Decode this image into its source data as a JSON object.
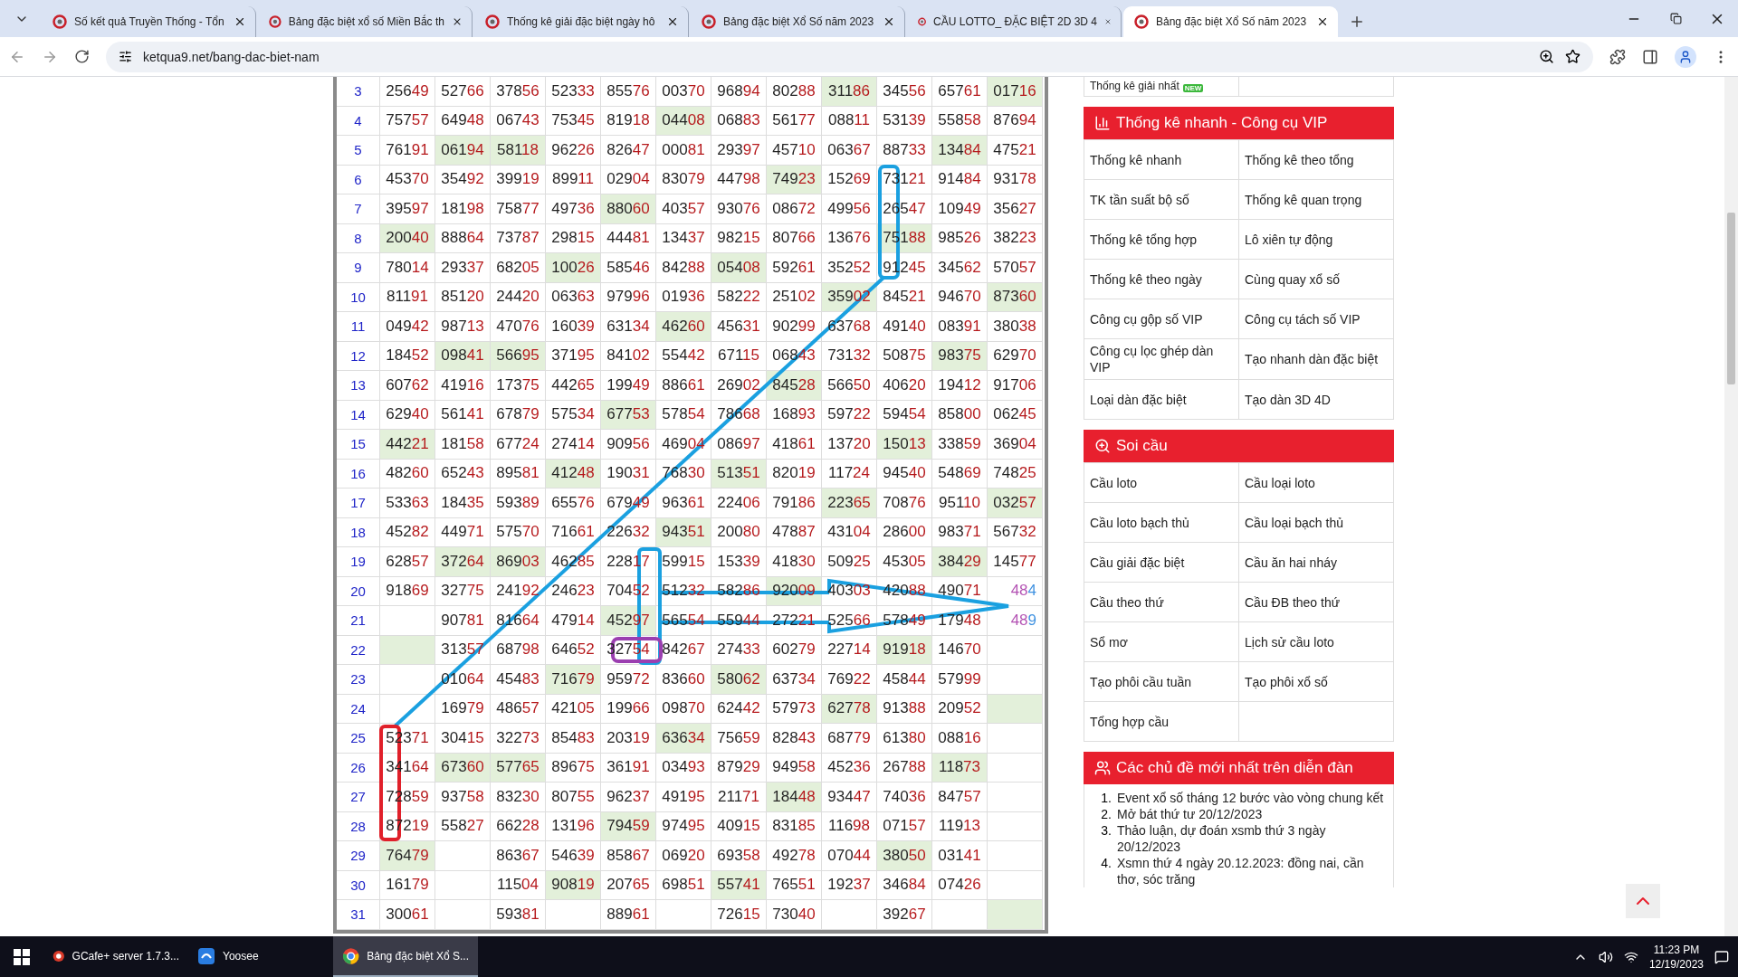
{
  "browser": {
    "tabs": [
      {
        "title": "Số kết quả Truyền Thống - Tổn",
        "selected": false
      },
      {
        "title": "Bảng đặc biệt xổ số Miền Bắc th",
        "selected": false
      },
      {
        "title": "Thống kê giải đặc biệt ngày hô",
        "selected": false
      },
      {
        "title": "Bảng đặc biệt Xổ Số năm 2023",
        "selected": false
      },
      {
        "title": "CẦU LOTTO_ ĐẶC BIỆT 2D 3D 4",
        "selected": false
      },
      {
        "title": "Bảng đặc biệt Xổ Số năm 2023",
        "selected": true
      }
    ],
    "url": "ketqua9.net/bang-dac-biet-nam"
  },
  "table": {
    "rows": [
      {
        "day": "3",
        "cells": [
          {
            "v": "25649",
            "hot": false
          },
          {
            "v": "52766",
            "hot": false
          },
          {
            "v": "37856",
            "hot": false
          },
          {
            "v": "52333",
            "hot": false
          },
          {
            "v": "85576",
            "hot": false
          },
          {
            "v": "00370",
            "hot": false
          },
          {
            "v": "96894",
            "hot": false
          },
          {
            "v": "80288",
            "hot": false
          },
          {
            "v": "31186",
            "hot": true
          },
          {
            "v": "34556",
            "hot": false
          },
          {
            "v": "65761",
            "hot": false
          },
          {
            "v": "01716",
            "hot": true
          }
        ]
      },
      {
        "day": "4",
        "cells": [
          {
            "v": "75757",
            "hot": false
          },
          {
            "v": "64948",
            "hot": false
          },
          {
            "v": "06743",
            "hot": false
          },
          {
            "v": "75345",
            "hot": false
          },
          {
            "v": "81918",
            "hot": false
          },
          {
            "v": "04408",
            "hot": true
          },
          {
            "v": "06883",
            "hot": false
          },
          {
            "v": "56177",
            "hot": false
          },
          {
            "v": "08811",
            "hot": false
          },
          {
            "v": "53139",
            "hot": false
          },
          {
            "v": "55858",
            "hot": false
          },
          {
            "v": "87694",
            "hot": false
          }
        ]
      },
      {
        "day": "5",
        "cells": [
          {
            "v": "76191",
            "hot": false
          },
          {
            "v": "06194",
            "hot": true
          },
          {
            "v": "58118",
            "hot": true
          },
          {
            "v": "96226",
            "hot": false
          },
          {
            "v": "82647",
            "hot": false
          },
          {
            "v": "00081",
            "hot": false
          },
          {
            "v": "29397",
            "hot": false
          },
          {
            "v": "45710",
            "hot": false
          },
          {
            "v": "06367",
            "hot": false
          },
          {
            "v": "88733",
            "hot": false
          },
          {
            "v": "13484",
            "hot": true
          },
          {
            "v": "47521",
            "hot": false
          }
        ]
      },
      {
        "day": "6",
        "cells": [
          {
            "v": "45370",
            "hot": false
          },
          {
            "v": "35492",
            "hot": false
          },
          {
            "v": "39919",
            "hot": false
          },
          {
            "v": "89911",
            "hot": false
          },
          {
            "v": "02904",
            "hot": false
          },
          {
            "v": "83079",
            "hot": false
          },
          {
            "v": "44798",
            "hot": false
          },
          {
            "v": "74923",
            "hot": true
          },
          {
            "v": "15269",
            "hot": false
          },
          {
            "v": "73121",
            "hot": false
          },
          {
            "v": "91484",
            "hot": false
          },
          {
            "v": "93178",
            "hot": false
          }
        ]
      },
      {
        "day": "7",
        "cells": [
          {
            "v": "39597",
            "hot": false
          },
          {
            "v": "18198",
            "hot": false
          },
          {
            "v": "75877",
            "hot": false
          },
          {
            "v": "49736",
            "hot": false
          },
          {
            "v": "88060",
            "hot": true
          },
          {
            "v": "40357",
            "hot": false
          },
          {
            "v": "93076",
            "hot": false
          },
          {
            "v": "08672",
            "hot": false
          },
          {
            "v": "49956",
            "hot": false
          },
          {
            "v": "26547",
            "hot": false
          },
          {
            "v": "10949",
            "hot": false
          },
          {
            "v": "35627",
            "hot": false
          }
        ]
      },
      {
        "day": "8",
        "cells": [
          {
            "v": "20040",
            "hot": true
          },
          {
            "v": "88864",
            "hot": false
          },
          {
            "v": "73787",
            "hot": false
          },
          {
            "v": "29815",
            "hot": false
          },
          {
            "v": "44481",
            "hot": false
          },
          {
            "v": "13437",
            "hot": false
          },
          {
            "v": "98215",
            "hot": false
          },
          {
            "v": "80766",
            "hot": false
          },
          {
            "v": "13676",
            "hot": false
          },
          {
            "v": "75188",
            "hot": true
          },
          {
            "v": "98526",
            "hot": false
          },
          {
            "v": "38223",
            "hot": false
          }
        ]
      },
      {
        "day": "9",
        "cells": [
          {
            "v": "78014",
            "hot": false
          },
          {
            "v": "29337",
            "hot": false
          },
          {
            "v": "68205",
            "hot": false
          },
          {
            "v": "10026",
            "hot": true
          },
          {
            "v": "58546",
            "hot": false
          },
          {
            "v": "84288",
            "hot": false
          },
          {
            "v": "05408",
            "hot": true
          },
          {
            "v": "59261",
            "hot": false
          },
          {
            "v": "35252",
            "hot": false
          },
          {
            "v": "91245",
            "hot": false
          },
          {
            "v": "34562",
            "hot": false
          },
          {
            "v": "57057",
            "hot": false
          }
        ]
      },
      {
        "day": "10",
        "cells": [
          {
            "v": "81191",
            "hot": false
          },
          {
            "v": "85120",
            "hot": false
          },
          {
            "v": "24420",
            "hot": false
          },
          {
            "v": "06363",
            "hot": false
          },
          {
            "v": "97996",
            "hot": false
          },
          {
            "v": "01936",
            "hot": false
          },
          {
            "v": "58222",
            "hot": false
          },
          {
            "v": "25102",
            "hot": false
          },
          {
            "v": "35902",
            "hot": true
          },
          {
            "v": "84521",
            "hot": false
          },
          {
            "v": "94670",
            "hot": false
          },
          {
            "v": "87360",
            "hot": true
          }
        ]
      },
      {
        "day": "11",
        "cells": [
          {
            "v": "04942",
            "hot": false
          },
          {
            "v": "98713",
            "hot": false
          },
          {
            "v": "47076",
            "hot": false
          },
          {
            "v": "16039",
            "hot": false
          },
          {
            "v": "63134",
            "hot": false
          },
          {
            "v": "46260",
            "hot": true
          },
          {
            "v": "45631",
            "hot": false
          },
          {
            "v": "90299",
            "hot": false
          },
          {
            "v": "63768",
            "hot": false
          },
          {
            "v": "49140",
            "hot": false
          },
          {
            "v": "08391",
            "hot": false
          },
          {
            "v": "38038",
            "hot": false
          }
        ]
      },
      {
        "day": "12",
        "cells": [
          {
            "v": "18452",
            "hot": false
          },
          {
            "v": "09841",
            "hot": true
          },
          {
            "v": "56695",
            "hot": true
          },
          {
            "v": "37195",
            "hot": false
          },
          {
            "v": "84102",
            "hot": false
          },
          {
            "v": "55442",
            "hot": false
          },
          {
            "v": "67115",
            "hot": false
          },
          {
            "v": "06843",
            "hot": false
          },
          {
            "v": "73132",
            "hot": false
          },
          {
            "v": "50875",
            "hot": false
          },
          {
            "v": "98375",
            "hot": true
          },
          {
            "v": "62970",
            "hot": false
          }
        ]
      },
      {
        "day": "13",
        "cells": [
          {
            "v": "60762",
            "hot": false
          },
          {
            "v": "41916",
            "hot": false
          },
          {
            "v": "17375",
            "hot": false
          },
          {
            "v": "44265",
            "hot": false
          },
          {
            "v": "19949",
            "hot": false
          },
          {
            "v": "88661",
            "hot": false
          },
          {
            "v": "26902",
            "hot": false
          },
          {
            "v": "84528",
            "hot": true
          },
          {
            "v": "56650",
            "hot": false
          },
          {
            "v": "40620",
            "hot": false
          },
          {
            "v": "19412",
            "hot": false
          },
          {
            "v": "91706",
            "hot": false
          }
        ]
      },
      {
        "day": "14",
        "cells": [
          {
            "v": "62940",
            "hot": false
          },
          {
            "v": "56141",
            "hot": false
          },
          {
            "v": "67879",
            "hot": false
          },
          {
            "v": "57534",
            "hot": false
          },
          {
            "v": "67753",
            "hot": true
          },
          {
            "v": "57854",
            "hot": false
          },
          {
            "v": "78668",
            "hot": false
          },
          {
            "v": "16893",
            "hot": false
          },
          {
            "v": "59722",
            "hot": false
          },
          {
            "v": "59454",
            "hot": false
          },
          {
            "v": "85800",
            "hot": false
          },
          {
            "v": "06245",
            "hot": false
          }
        ]
      },
      {
        "day": "15",
        "cells": [
          {
            "v": "44221",
            "hot": true
          },
          {
            "v": "18158",
            "hot": false
          },
          {
            "v": "67724",
            "hot": false
          },
          {
            "v": "27414",
            "hot": false
          },
          {
            "v": "90956",
            "hot": false
          },
          {
            "v": "46904",
            "hot": false
          },
          {
            "v": "08697",
            "hot": false
          },
          {
            "v": "41861",
            "hot": false
          },
          {
            "v": "13720",
            "hot": false
          },
          {
            "v": "15013",
            "hot": true
          },
          {
            "v": "33859",
            "hot": false
          },
          {
            "v": "36904",
            "hot": false
          }
        ]
      },
      {
        "day": "16",
        "cells": [
          {
            "v": "48260",
            "hot": false
          },
          {
            "v": "65243",
            "hot": false
          },
          {
            "v": "89581",
            "hot": false
          },
          {
            "v": "41248",
            "hot": true
          },
          {
            "v": "19031",
            "hot": false
          },
          {
            "v": "76830",
            "hot": false
          },
          {
            "v": "51351",
            "hot": true
          },
          {
            "v": "82019",
            "hot": false
          },
          {
            "v": "11724",
            "hot": false
          },
          {
            "v": "94540",
            "hot": false
          },
          {
            "v": "54869",
            "hot": false
          },
          {
            "v": "74825",
            "hot": false
          }
        ]
      },
      {
        "day": "17",
        "cells": [
          {
            "v": "53363",
            "hot": false
          },
          {
            "v": "18435",
            "hot": false
          },
          {
            "v": "59389",
            "hot": false
          },
          {
            "v": "65576",
            "hot": false
          },
          {
            "v": "67949",
            "hot": false
          },
          {
            "v": "96361",
            "hot": false
          },
          {
            "v": "22406",
            "hot": false
          },
          {
            "v": "79186",
            "hot": false
          },
          {
            "v": "22365",
            "hot": true
          },
          {
            "v": "70876",
            "hot": false
          },
          {
            "v": "95110",
            "hot": false
          },
          {
            "v": "03257",
            "hot": true
          }
        ]
      },
      {
        "day": "18",
        "cells": [
          {
            "v": "45282",
            "hot": false
          },
          {
            "v": "44971",
            "hot": false
          },
          {
            "v": "57570",
            "hot": false
          },
          {
            "v": "71661",
            "hot": false
          },
          {
            "v": "22632",
            "hot": false
          },
          {
            "v": "94351",
            "hot": true
          },
          {
            "v": "20080",
            "hot": false
          },
          {
            "v": "47887",
            "hot": false
          },
          {
            "v": "43104",
            "hot": false
          },
          {
            "v": "28600",
            "hot": false
          },
          {
            "v": "98371",
            "hot": false
          },
          {
            "v": "56732",
            "hot": false
          }
        ]
      },
      {
        "day": "19",
        "cells": [
          {
            "v": "62857",
            "hot": false
          },
          {
            "v": "37264",
            "hot": true
          },
          {
            "v": "86903",
            "hot": true
          },
          {
            "v": "46285",
            "hot": false
          },
          {
            "v": "22817",
            "hot": false
          },
          {
            "v": "59915",
            "hot": false
          },
          {
            "v": "15339",
            "hot": false
          },
          {
            "v": "41830",
            "hot": false
          },
          {
            "v": "50925",
            "hot": false
          },
          {
            "v": "45305",
            "hot": false
          },
          {
            "v": "38429",
            "hot": true
          },
          {
            "v": "14577",
            "hot": false
          }
        ]
      },
      {
        "day": "20",
        "cells": [
          {
            "v": "91869",
            "hot": false
          },
          {
            "v": "32775",
            "hot": false
          },
          {
            "v": "24192",
            "hot": false
          },
          {
            "v": "24623",
            "hot": false
          },
          {
            "v": "70452",
            "hot": false
          },
          {
            "v": "51232",
            "hot": false
          },
          {
            "v": "58286",
            "hot": false
          },
          {
            "v": "92009",
            "hot": true
          },
          {
            "v": "40303",
            "hot": false
          },
          {
            "v": "42088",
            "hot": false
          },
          {
            "v": "49071",
            "hot": false
          },
          {
            "v": "484",
            "hot": false
          }
        ]
      },
      {
        "day": "21",
        "cells": [
          {
            "hot": false
          },
          {
            "v": "90781",
            "hot": false
          },
          {
            "v": "81664",
            "hot": false
          },
          {
            "v": "47914",
            "hot": false
          },
          {
            "v": "45297",
            "hot": true
          },
          {
            "v": "56554",
            "hot": false
          },
          {
            "v": "55944",
            "hot": false
          },
          {
            "v": "27221",
            "hot": false
          },
          {
            "v": "52566",
            "hot": false
          },
          {
            "v": "57849",
            "hot": false
          },
          {
            "v": "17948",
            "hot": false
          },
          {
            "v": "489",
            "hot": false
          }
        ]
      },
      {
        "day": "22",
        "cells": [
          {
            "hot": true
          },
          {
            "v": "31357",
            "hot": false
          },
          {
            "v": "68798",
            "hot": false
          },
          {
            "v": "64652",
            "hot": false
          },
          {
            "v": "32754",
            "hot": false
          },
          {
            "v": "84267",
            "hot": false
          },
          {
            "v": "27433",
            "hot": false
          },
          {
            "v": "60279",
            "hot": false
          },
          {
            "v": "22714",
            "hot": false
          },
          {
            "v": "91918",
            "hot": true
          },
          {
            "v": "14670",
            "hot": false
          },
          {
            "hot": false
          }
        ]
      },
      {
        "day": "23",
        "cells": [
          {
            "hot": false
          },
          {
            "v": "01064",
            "hot": false
          },
          {
            "v": "45483",
            "hot": false
          },
          {
            "v": "71679",
            "hot": true
          },
          {
            "v": "95972",
            "hot": false
          },
          {
            "v": "83660",
            "hot": false
          },
          {
            "v": "58062",
            "hot": true
          },
          {
            "v": "63734",
            "hot": false
          },
          {
            "v": "76922",
            "hot": false
          },
          {
            "v": "45844",
            "hot": false
          },
          {
            "v": "57999",
            "hot": false
          },
          {
            "hot": false
          }
        ]
      },
      {
        "day": "24",
        "cells": [
          {
            "hot": false
          },
          {
            "v": "16979",
            "hot": false
          },
          {
            "v": "48657",
            "hot": false
          },
          {
            "v": "42105",
            "hot": false
          },
          {
            "v": "19966",
            "hot": false
          },
          {
            "v": "09870",
            "hot": false
          },
          {
            "v": "62442",
            "hot": false
          },
          {
            "v": "57973",
            "hot": false
          },
          {
            "v": "62778",
            "hot": true
          },
          {
            "v": "91388",
            "hot": false
          },
          {
            "v": "20952",
            "hot": false
          },
          {
            "hot": true
          }
        ]
      },
      {
        "day": "25",
        "cells": [
          {
            "v": "52371",
            "hot": false
          },
          {
            "v": "30415",
            "hot": false
          },
          {
            "v": "32273",
            "hot": false
          },
          {
            "v": "85483",
            "hot": false
          },
          {
            "v": "20319",
            "hot": false
          },
          {
            "v": "63634",
            "hot": true
          },
          {
            "v": "75659",
            "hot": false
          },
          {
            "v": "82843",
            "hot": false
          },
          {
            "v": "68779",
            "hot": false
          },
          {
            "v": "61380",
            "hot": false
          },
          {
            "v": "08816",
            "hot": false
          },
          {
            "hot": false
          }
        ]
      },
      {
        "day": "26",
        "cells": [
          {
            "v": "34164",
            "hot": false
          },
          {
            "v": "67360",
            "hot": true
          },
          {
            "v": "57765",
            "hot": true
          },
          {
            "v": "89675",
            "hot": false
          },
          {
            "v": "36191",
            "hot": false
          },
          {
            "v": "03493",
            "hot": false
          },
          {
            "v": "87929",
            "hot": false
          },
          {
            "v": "94958",
            "hot": false
          },
          {
            "v": "45236",
            "hot": false
          },
          {
            "v": "26788",
            "hot": false
          },
          {
            "v": "11873",
            "hot": true
          },
          {
            "hot": false
          }
        ]
      },
      {
        "day": "27",
        "cells": [
          {
            "v": "72859",
            "hot": false
          },
          {
            "v": "93758",
            "hot": false
          },
          {
            "v": "83230",
            "hot": false
          },
          {
            "v": "80755",
            "hot": false
          },
          {
            "v": "96237",
            "hot": false
          },
          {
            "v": "49195",
            "hot": false
          },
          {
            "v": "21171",
            "hot": false
          },
          {
            "v": "18448",
            "hot": true
          },
          {
            "v": "93447",
            "hot": false
          },
          {
            "v": "74036",
            "hot": false
          },
          {
            "v": "84757",
            "hot": false
          },
          {
            "hot": false
          }
        ]
      },
      {
        "day": "28",
        "cells": [
          {
            "v": "87219",
            "hot": false
          },
          {
            "v": "55827",
            "hot": false
          },
          {
            "v": "66228",
            "hot": false
          },
          {
            "v": "13196",
            "hot": false
          },
          {
            "v": "79459",
            "hot": true
          },
          {
            "v": "97495",
            "hot": false
          },
          {
            "v": "40915",
            "hot": false
          },
          {
            "v": "83185",
            "hot": false
          },
          {
            "v": "11698",
            "hot": false
          },
          {
            "v": "07157",
            "hot": false
          },
          {
            "v": "11913",
            "hot": false
          },
          {
            "hot": false
          }
        ]
      },
      {
        "day": "29",
        "cells": [
          {
            "v": "76479",
            "hot": true
          },
          {
            "hot": false
          },
          {
            "v": "86367",
            "hot": false
          },
          {
            "v": "54639",
            "hot": false
          },
          {
            "v": "85867",
            "hot": false
          },
          {
            "v": "06920",
            "hot": false
          },
          {
            "v": "69358",
            "hot": false
          },
          {
            "v": "49278",
            "hot": false
          },
          {
            "v": "07044",
            "hot": false
          },
          {
            "v": "38050",
            "hot": true
          },
          {
            "v": "03141",
            "hot": false
          },
          {
            "hot": false
          }
        ]
      },
      {
        "day": "30",
        "cells": [
          {
            "v": "16179",
            "hot": false
          },
          {
            "hot": false
          },
          {
            "v": "11504",
            "hot": false
          },
          {
            "v": "90819",
            "hot": true
          },
          {
            "v": "20765",
            "hot": false
          },
          {
            "v": "69851",
            "hot": false
          },
          {
            "v": "55741",
            "hot": true
          },
          {
            "v": "76551",
            "hot": false
          },
          {
            "v": "19237",
            "hot": false
          },
          {
            "v": "34684",
            "hot": false
          },
          {
            "v": "07426",
            "hot": false
          },
          {
            "hot": false
          }
        ]
      },
      {
        "day": "31",
        "cells": [
          {
            "v": "30061",
            "hot": false
          },
          {
            "hot": false
          },
          {
            "v": "59381",
            "hot": false
          },
          {
            "hot": false
          },
          {
            "v": "88961",
            "hot": false
          },
          {
            "hot": false
          },
          {
            "v": "72615",
            "hot": false
          },
          {
            "v": "73040",
            "hot": false
          },
          {
            "hot": false
          },
          {
            "v": "39267",
            "hot": false
          },
          {
            "hot": false
          },
          {
            "hot": true
          }
        ]
      }
    ]
  },
  "sidebar": {
    "top_item": {
      "label": "Thống kê giải nhất",
      "badge": "NEW"
    },
    "sections": [
      {
        "title": "Thống kê nhanh - Công cụ VIP",
        "links": [
          "Thống kê nhanh",
          "Thống kê theo tổng",
          "TK tần suất bộ số",
          "Thống kê quan trọng",
          "Thống kê tổng hợp",
          "Lô xiên tự động",
          "Thống kê theo ngày",
          "Cùng quay xổ số",
          "Công cụ gộp số VIP",
          "Công cụ tách số VIP",
          "Công cụ lọc ghép dàn VIP",
          "Tạo nhanh dàn đặc biệt",
          "Loại dàn đặc biệt",
          "Tạo dàn 3D 4D"
        ]
      },
      {
        "title": "Soi cầu",
        "links": [
          "Cầu loto",
          "Cầu loại loto",
          "Cầu loto bạch thủ",
          "Cầu loại bạch thủ",
          "Cầu giải đặc biệt",
          "Cầu ăn hai nháy",
          "Cầu theo thứ",
          "Cầu ĐB theo thứ",
          "Sổ mơ",
          "Lịch sử cầu loto",
          "Tạo phôi cầu tuần",
          "Tạo phôi xổ số",
          "Tổng hợp cầu"
        ]
      }
    ],
    "forum": {
      "title": "Các chủ đề mới nhất trên diễn đàn",
      "items": [
        {
          "n": "1.",
          "text": "Event xổ số tháng 12 bước vào vòng chung kết"
        },
        {
          "n": "2.",
          "text": "Mở bát thứ tư 20/12/2023"
        },
        {
          "n": "3.",
          "text": "Thảo luận, dự đoán xsmb thứ 3 ngày 20/12/2023"
        },
        {
          "n": "4.",
          "text": "Xsmn thứ 4 ngày 20.12.2023: đồng nai, cần thơ, sóc trăng"
        }
      ]
    }
  },
  "taskbar": {
    "apps": [
      {
        "label": "GCafe+ server 1.7.3...",
        "selected": false
      },
      {
        "label": "Yoosee",
        "selected": false
      },
      {
        "label": "Bảng đặc biệt Xổ S...",
        "selected": true
      }
    ],
    "time": "11:23 PM",
    "date": "12/19/2023"
  }
}
